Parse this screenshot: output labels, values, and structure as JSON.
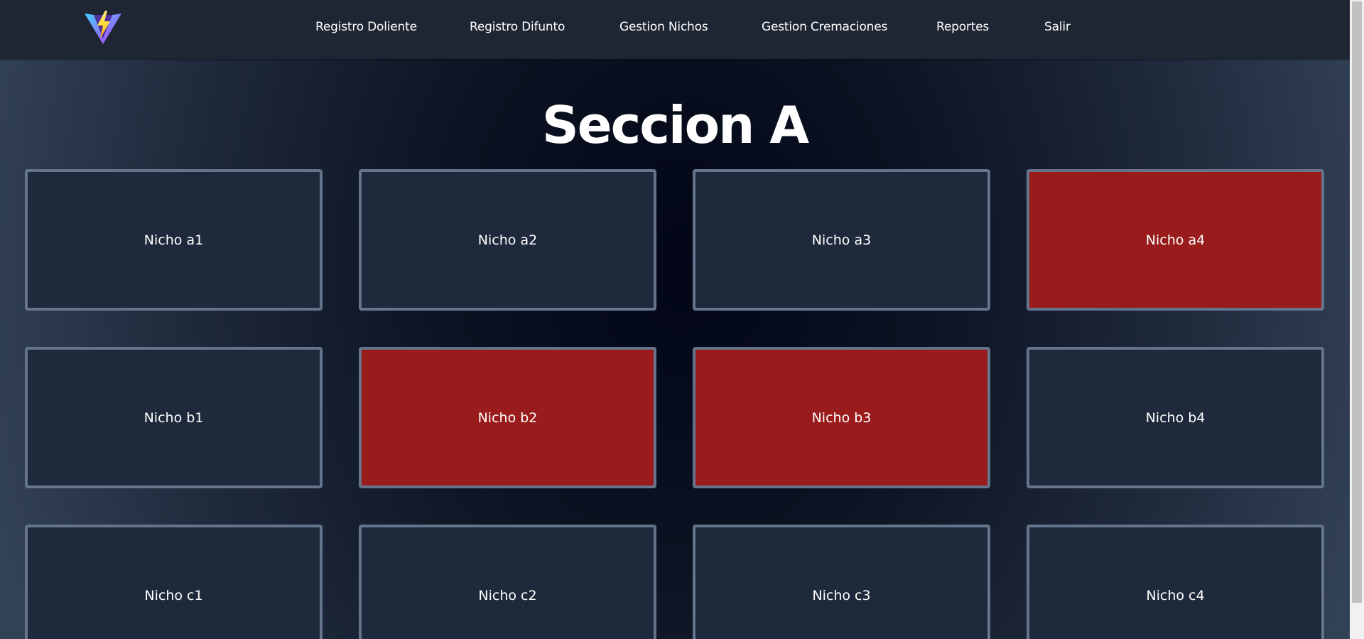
{
  "nav": {
    "logo_icon": "vite-logo-icon",
    "links": [
      "Registro Doliente",
      "Registro Difunto",
      "Gestion Nichos",
      "Gestion Cremaciones",
      "Reportes",
      "Salir"
    ]
  },
  "section": {
    "title": "Seccion A"
  },
  "niches": [
    {
      "label": "Nicho a1",
      "occupied": false
    },
    {
      "label": "Nicho a2",
      "occupied": false
    },
    {
      "label": "Nicho a3",
      "occupied": false
    },
    {
      "label": "Nicho a4",
      "occupied": true
    },
    {
      "label": "Nicho b1",
      "occupied": false
    },
    {
      "label": "Nicho b2",
      "occupied": true
    },
    {
      "label": "Nicho b3",
      "occupied": true
    },
    {
      "label": "Nicho b4",
      "occupied": false
    },
    {
      "label": "Nicho c1",
      "occupied": false
    },
    {
      "label": "Nicho c2",
      "occupied": false
    },
    {
      "label": "Nicho c3",
      "occupied": false
    },
    {
      "label": "Nicho c4",
      "occupied": false
    }
  ],
  "colors": {
    "navbar_bg": "#1e2533",
    "niche_free_bg": "#1e293b",
    "niche_occupied_bg": "#991b1b",
    "niche_border": "#64748b"
  }
}
